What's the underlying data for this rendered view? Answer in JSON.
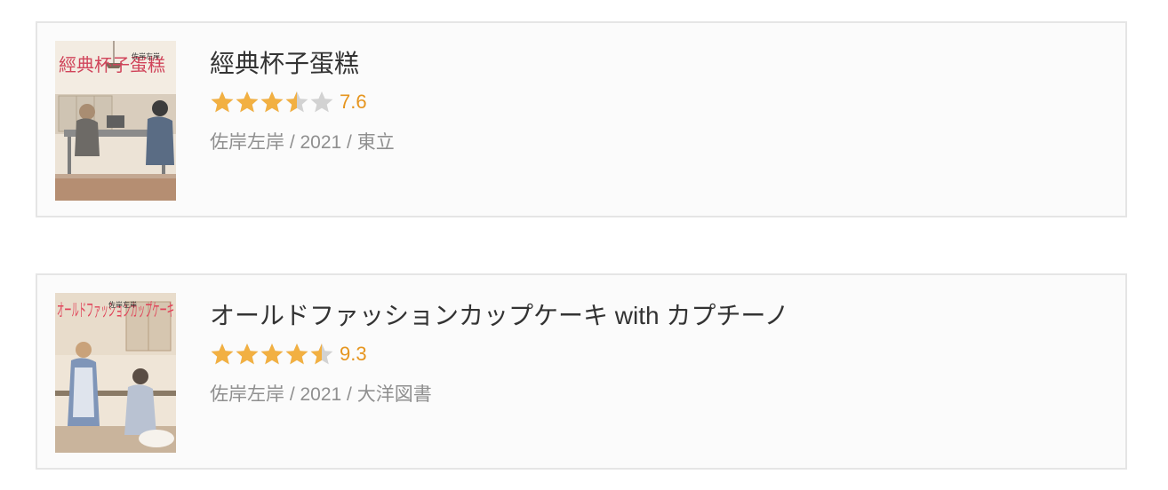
{
  "colors": {
    "star_filled": "#f2b042",
    "star_empty": "#d2d2d2",
    "score": "#e6951e",
    "title": "#333333",
    "meta": "#8f8f8f",
    "card_border": "#e5e5e5"
  },
  "books": [
    {
      "title": "經典杯子蛋糕",
      "rating_stars": 3.5,
      "rating_max": 5,
      "score": "7.6",
      "meta": "佐岸左岸 / 2021 / 東立",
      "cover": {
        "title_text": "經典杯子蛋糕",
        "author_text": "佐岸左岸"
      }
    },
    {
      "title": "オールドファッションカップケーキ with カプチーノ",
      "rating_stars": 4.5,
      "rating_max": 5,
      "score": "9.3",
      "meta": "佐岸左岸 / 2021 / 大洋図書",
      "cover": {
        "title_text": "オールドファッションカップケーキ",
        "author_text": "佐岸左岸"
      }
    }
  ]
}
